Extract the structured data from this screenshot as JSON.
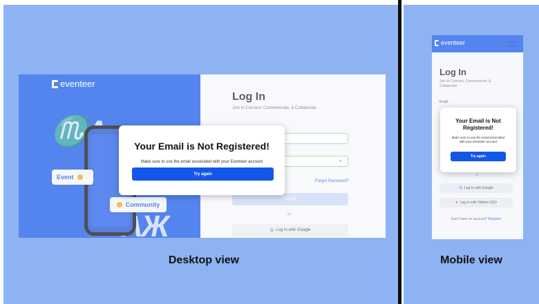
{
  "brand": "eventeer",
  "captions": {
    "desktop": "Desktop view",
    "mobile": "Mobile view"
  },
  "desktop": {
    "decor": {
      "top": "♏Ʌ",
      "bottom": "ɅЖ"
    },
    "tags": {
      "event": "Event",
      "community": "Community"
    },
    "login_title": "Log In",
    "login_subtitle": "Join to Connect, Communicate, & Collaborate",
    "forgot_password": "Forgot Password?",
    "login_button": "Log in",
    "or": "or",
    "google_button": "Log In with Google",
    "modal": {
      "title": "Your Email is Not Registered!",
      "text": "Make sure to use the email associated with your Eventeer account",
      "button": "Try again"
    }
  },
  "mobile": {
    "login_title": "Log In",
    "login_subtitle": "Join to Connect, Communicate, & Collaborate",
    "email_label": "Email",
    "or": "or",
    "google_button": "Log In with Google",
    "sso_button": "Log In with Telkom SSO",
    "signup_prompt": "Don't have an account?",
    "signup_link": "Register",
    "modal": {
      "title": "Your Email is Not Registered!",
      "text": "Make sure to use the email associated with your Eventeer account",
      "button": "Try again"
    }
  },
  "colors": {
    "background": "#8eb3f2",
    "brand_blue": "#1357e8",
    "accent": "#f7a11a"
  }
}
